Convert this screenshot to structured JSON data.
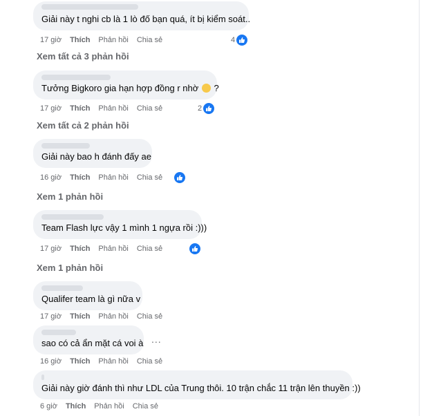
{
  "comments": [
    {
      "text": "Giải này t nghi cb là 1 lò đố bạn quá, ít bị kiểm soát..",
      "time": "17 giờ",
      "like": "Thích",
      "reply": "Phản hồi",
      "share": "Chia sẻ",
      "reactions": "4"
    },
    {
      "text_before": "Tưởng Bigkoro gia hạn hợp đồng r nhờ",
      "text_after": "?",
      "time": "17 giờ",
      "like": "Thích",
      "reply": "Phản hồi",
      "share": "Chia sẻ",
      "reactions": "2"
    },
    {
      "text": "Giải này bao h đánh đấy ae",
      "time": "16 giờ",
      "like": "Thích",
      "reply": "Phản hồi",
      "share": "Chia sẻ",
      "reactions": ""
    },
    {
      "text": "Team Flash lực vậy 1 mình 1 ngựa rồi :)))",
      "time": "17 giờ",
      "like": "Thích",
      "reply": "Phản hồi",
      "share": "Chia sẻ",
      "reactions": ""
    },
    {
      "text": "Qualifer team là gì nữa v",
      "time": "17 giờ",
      "like": "Thích",
      "reply": "Phản hồi",
      "share": "Chia sẻ"
    },
    {
      "text": "sao có cả ẩn mặt cá voi à",
      "time": "16 giờ",
      "like": "Thích",
      "reply": "Phản hồi",
      "share": "Chia sẻ",
      "more": "..."
    },
    {
      "text": "Giải này giờ đánh thì như LDL của Trung thôi. 10 trận chắc 11 trận lên thuyền :))",
      "time": "6 giờ",
      "like": "Thích",
      "reply": "Phản hồi",
      "share": "Chia sẻ"
    }
  ],
  "view_replies": [
    "Xem tất cả 3 phản hồi",
    "Xem tất cả 2 phản hồi",
    "Xem 1 phản hồi",
    "Xem 1 phản hồi"
  ],
  "colors": {
    "like_blue": "#1877f2",
    "bubble": "#f0f2f5",
    "meta_text": "#65676b"
  },
  "icons": {
    "reaction": "like-icon",
    "emoji": "grinning-emoji"
  }
}
